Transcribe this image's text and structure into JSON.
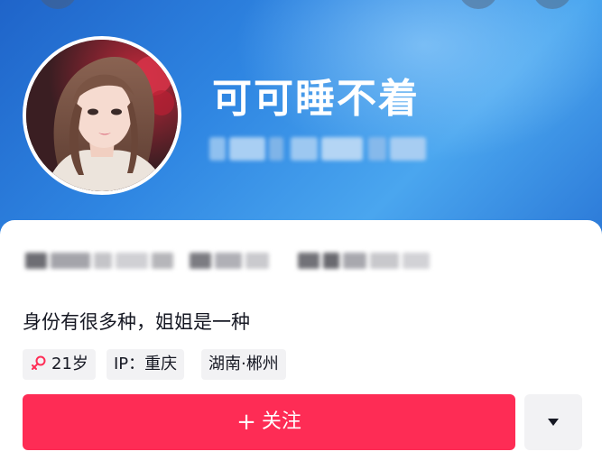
{
  "profile": {
    "username": "可可睡不着",
    "bio": "身份有很多种，姐姐是一种",
    "avatar_alt": "avatar"
  },
  "tags": {
    "age": "21岁",
    "ip": "IP：重庆",
    "location": "湖南·郴州",
    "gender_icon": "female-icon"
  },
  "actions": {
    "follow_label": "关注",
    "follow_plus": "+",
    "more_icon": "caret-down-icon"
  },
  "colors": {
    "follow_bg": "#fe2c55",
    "female_icon": "#fe2c55",
    "header_gradient_start": "#1f64c9",
    "header_gradient_end": "#4aa6ef",
    "tag_bg": "#f2f2f4"
  }
}
